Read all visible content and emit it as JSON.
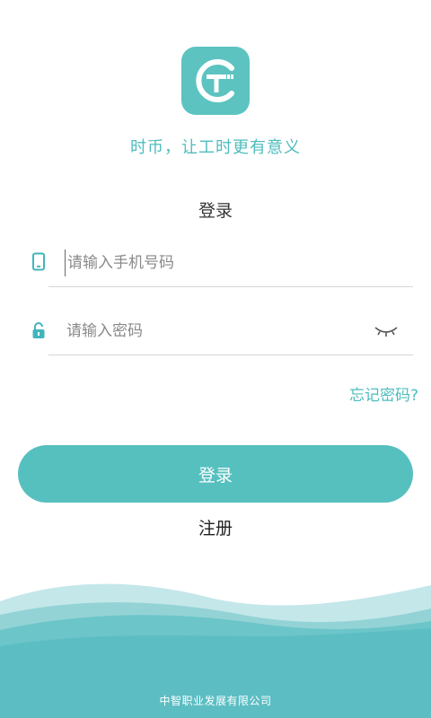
{
  "app": {
    "logo_icon": "ct-logo-icon",
    "slogan": "时币，让工时更有意义"
  },
  "form": {
    "title": "登录",
    "phone": {
      "icon": "phone-icon",
      "placeholder": "请输入手机号码",
      "value": ""
    },
    "password": {
      "icon": "lock-icon",
      "placeholder": "请输入密码",
      "value": "",
      "toggle_icon": "eye-closed-icon"
    },
    "forgot_label": "忘记密码?",
    "login_label": "登录",
    "register_label": "注册"
  },
  "footer": {
    "company": "中智职业发展有限公司"
  },
  "colors": {
    "brand": "#56c0bf",
    "text": "#333333",
    "placeholder": "#8a8a8a"
  }
}
